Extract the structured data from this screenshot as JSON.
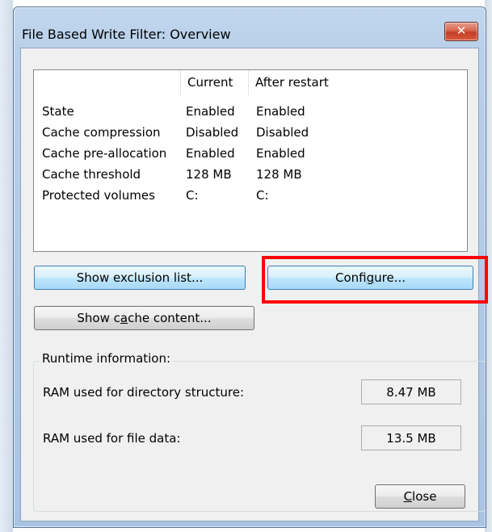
{
  "window": {
    "title": "File Based Write Filter: Overview",
    "close_glyph": "✕"
  },
  "table": {
    "columns": [
      "",
      "Current",
      "After restart"
    ],
    "rows": [
      {
        "label": "State",
        "current": "Enabled",
        "after": "Enabled"
      },
      {
        "label": "Cache compression",
        "current": "Disabled",
        "after": "Disabled"
      },
      {
        "label": "Cache pre-allocation",
        "current": "Enabled",
        "after": "Enabled"
      },
      {
        "label": "Cache threshold",
        "current": "128 MB",
        "after": "128 MB"
      },
      {
        "label": "Protected volumes",
        "current": "C:",
        "after": "C:"
      }
    ]
  },
  "buttons": {
    "exclusion": {
      "pre": "Show exclusion list...",
      "acc": "",
      "post": ""
    },
    "configure": {
      "pre": "Confi",
      "acc": "g",
      "post": "ure..."
    },
    "cache": {
      "pre": "Show c",
      "acc": "a",
      "post": "che content..."
    },
    "close": {
      "pre": "",
      "acc": "C",
      "post": "lose"
    }
  },
  "runtime": {
    "group_label": "Runtime information:",
    "dir_label": "RAM used for directory structure:",
    "dir_value": "8.47 MB",
    "file_label": "RAM used for file data:",
    "file_value": "13.5 MB"
  },
  "colors": {
    "highlight": "#ff0000",
    "title_bar": "#b9d0ea",
    "close_button": "#c33f26"
  }
}
